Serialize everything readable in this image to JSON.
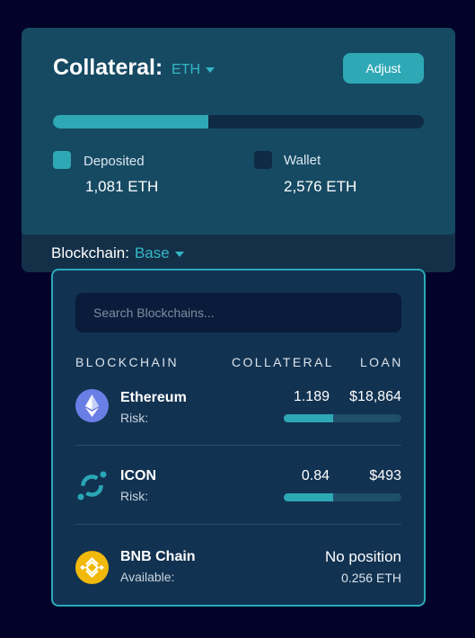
{
  "collateral": {
    "title": "Collateral:",
    "asset": "ETH",
    "adjust_label": "Adjust",
    "deposited_fraction": 0.42,
    "deposited": {
      "label": "Deposited",
      "value": "1,081 ETH",
      "color": "#2ea8b5"
    },
    "wallet": {
      "label": "Wallet",
      "value": "2,576 ETH",
      "color": "#0e2a44"
    }
  },
  "blockchain_select": {
    "label": "Blockchain:",
    "value": "Base"
  },
  "panel": {
    "search_placeholder": "Search Blockchains...",
    "columns": [
      "BLOCKCHAIN",
      "COLLATERAL",
      "LOAN"
    ],
    "rows": [
      {
        "icon": "ethereum-icon",
        "name": "Ethereum",
        "sub": "Risk:",
        "collateral": "1.189",
        "loan": "$18,864",
        "risk_fraction": 0.42
      },
      {
        "icon": "icon-network-icon",
        "name": "ICON",
        "sub": "Risk:",
        "collateral": "0.84",
        "loan": "$493",
        "risk_fraction": 0.42
      },
      {
        "icon": "bnb-chain-icon",
        "name": "BNB Chain",
        "sub": "Available:",
        "status": "No position",
        "available": "0.256 ETH"
      }
    ]
  },
  "colors": {
    "background": "#03032a",
    "accent": "#2ea8b5",
    "card": "#164a63",
    "panel": "#123251"
  }
}
